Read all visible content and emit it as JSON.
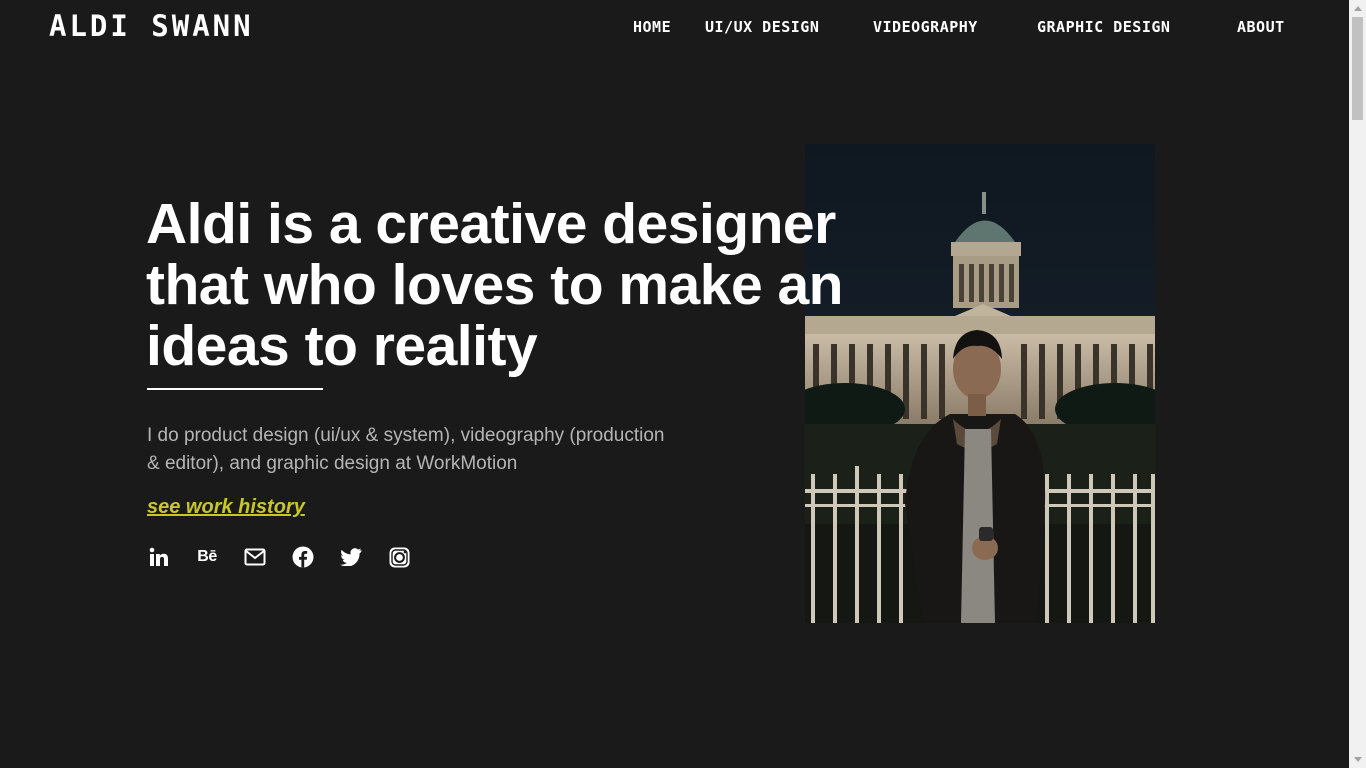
{
  "header": {
    "logo": "ALDI SWANN",
    "nav": [
      "HOME",
      "UI/UX DESIGN",
      "VIDEOGRAPHY",
      "GRAPHIC DESIGN",
      "ABOUT"
    ]
  },
  "hero": {
    "headline": "Aldi is a creative designer that who loves to make an ideas to reality",
    "description": "I do product design (ui/ux & system), videography (production & editor), and graphic design at WorkMotion",
    "link_label": "see work history",
    "link_color": "#c9c62c",
    "socials": [
      "linkedin-icon",
      "behance-icon",
      "mail-icon",
      "facebook-icon",
      "twitter-icon",
      "instagram-icon"
    ],
    "behance_glyph": "Bē"
  },
  "colors": {
    "background": "#1a1a1a",
    "text": "#ffffff",
    "muted_text": "#b5b5b5",
    "accent": "#c9c62c"
  }
}
